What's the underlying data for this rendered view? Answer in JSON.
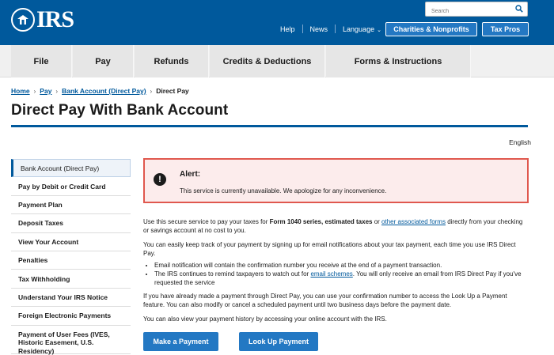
{
  "header": {
    "logo_text": "IRS",
    "search_placeholder": "Search",
    "links": [
      "Help",
      "News",
      "Language"
    ],
    "charities_button": "Charities & Nonprofits",
    "taxpros_button": "Tax Pros"
  },
  "nav": {
    "items": [
      "File",
      "Pay",
      "Refunds",
      "Credits & Deductions",
      "Forms & Instructions"
    ]
  },
  "breadcrumb": {
    "items": [
      "Home",
      "Pay",
      "Bank Account (Direct Pay)"
    ],
    "current": "Direct Pay"
  },
  "page": {
    "title": "Direct Pay With Bank Account",
    "language": "English"
  },
  "sidebar": {
    "items": [
      "Bank Account (Direct Pay)",
      "Pay by Debit or Credit Card",
      "Payment Plan",
      "Deposit Taxes",
      "View Your Account",
      "Penalties",
      "Tax Withholding",
      "Understand Your IRS Notice",
      "Foreign Electronic Payments",
      "Payment of User Fees (IVES, Historic Easement, U.S. Residency)"
    ]
  },
  "alert": {
    "title": "Alert:",
    "message": "This service is currently unavailable. We apologize for any inconvenience."
  },
  "content": {
    "p1_a": "Use this secure service to pay your taxes for ",
    "p1_bold": "Form 1040 series, estimated taxes",
    "p1_b": " or ",
    "p1_link": "other associated forms",
    "p1_c": " directly from your checking or savings account at no cost to you.",
    "p2": "You can easily keep track of your payment by signing up for email notifications about your tax payment, each time you use IRS Direct Pay.",
    "bullet1": "Email notification will contain the confirmation number you receive at the end of a payment transaction.",
    "bullet2_a": "The IRS continues to remind taxpayers to watch out for ",
    "bullet2_link": "email schemes",
    "bullet2_b": ". You will only receive an email from IRS Direct Pay if you've requested the service",
    "p3": "If you have already made a payment through Direct Pay, you can use your confirmation number to access the Look Up a Payment feature. You can also modify or cancel a scheduled payment until two business days before the payment date.",
    "p4": "You can also view your payment history by accessing your online account with the IRS."
  },
  "buttons": {
    "make_payment": "Make a Payment",
    "look_up_payment": "Look Up Payment"
  },
  "colors": {
    "header_blue": "#00599c",
    "button_blue": "#2378c3",
    "alert_border": "#e0584e",
    "alert_bg": "#fcecec"
  }
}
